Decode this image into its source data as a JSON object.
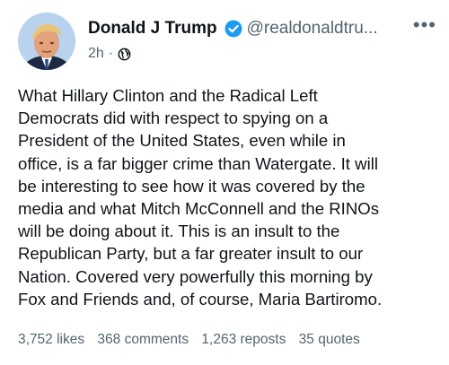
{
  "post": {
    "author": {
      "display_name": "Donald J Trump",
      "handle": "@realdonaldtru...",
      "verified": true,
      "avatar_icon": "profile-photo"
    },
    "timestamp": "2h",
    "visibility_icon": "globe-icon",
    "body": "What Hillary Clinton and the Radical Left\nDemocrats did with respect to spying on a\nPresident of the United States, even while in\noffice, is a far bigger crime than Watergate. It will\nbe interesting to see how it was covered by the\nmedia and what Mitch McConnell and the RINOs\nwill be doing about it. This is an insult to the\nRepublican Party, but a far greater insult to our\nNation. Covered very powerfully this morning by\nFox and Friends and, of course, Maria Bartiromo.",
    "stats": {
      "likes": "3,752 likes",
      "comments": "368 comments",
      "reposts": "1,263 reposts",
      "quotes": "35 quotes"
    },
    "more_menu_label": "•••"
  },
  "colors": {
    "text_primary": "#0f1419",
    "text_secondary": "#536471",
    "verified_blue": "#1d9bf0",
    "background": "#ffffff"
  }
}
